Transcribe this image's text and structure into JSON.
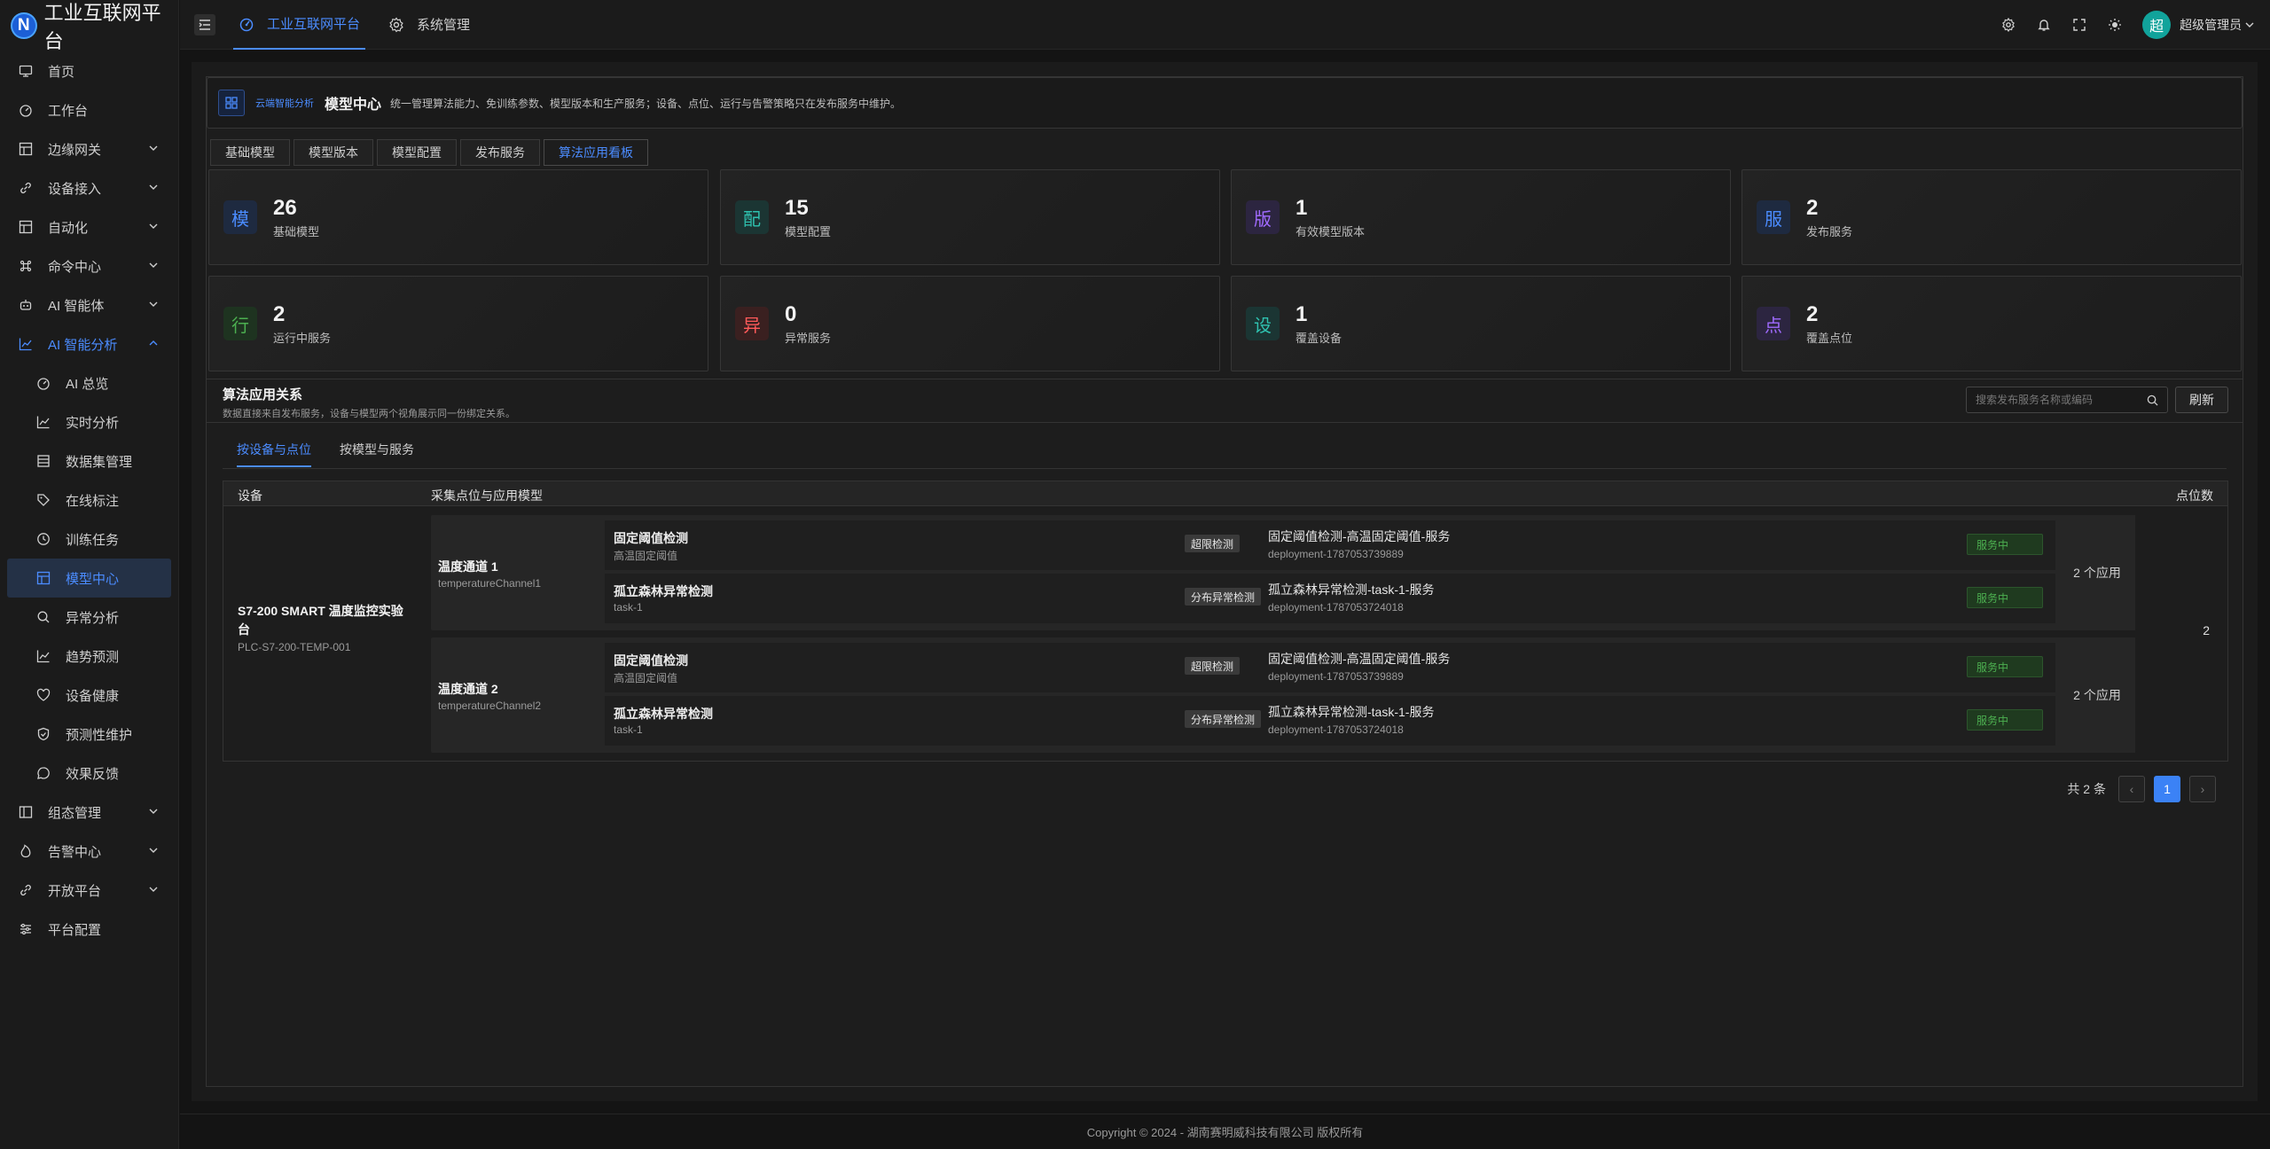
{
  "app": {
    "logo_letter": "N",
    "title": "工业互联网平台"
  },
  "header": {
    "tabs": [
      {
        "label": "工业互联网平台",
        "icon": "platform-icon"
      },
      {
        "label": "系统管理",
        "icon": "gear-icon"
      }
    ],
    "user": {
      "avatar_letter": "超",
      "name": "超级管理员"
    }
  },
  "sidebar": {
    "items": [
      {
        "label": "首页",
        "icon": "monitor-icon"
      },
      {
        "label": "工作台",
        "icon": "dashboard-icon"
      },
      {
        "label": "边缘网关",
        "icon": "grid-icon",
        "expandable": true
      },
      {
        "label": "设备接入",
        "icon": "link-icon",
        "expandable": true
      },
      {
        "label": "自动化",
        "icon": "grid-icon",
        "expandable": true
      },
      {
        "label": "命令中心",
        "icon": "command-icon",
        "expandable": true
      },
      {
        "label": "AI 智能体",
        "icon": "robot-icon",
        "expandable": true
      },
      {
        "label": "AI 智能分析",
        "icon": "chart-line-icon",
        "expandable": true,
        "open": true
      }
    ],
    "sub_items": [
      {
        "label": "AI 总览",
        "icon": "dashboard-icon"
      },
      {
        "label": "实时分析",
        "icon": "chart-line-icon"
      },
      {
        "label": "数据集管理",
        "icon": "table-icon"
      },
      {
        "label": "在线标注",
        "icon": "tag-icon"
      },
      {
        "label": "训练任务",
        "icon": "clock-icon"
      },
      {
        "label": "模型中心",
        "icon": "grid-icon",
        "active": true
      },
      {
        "label": "异常分析",
        "icon": "search-icon"
      },
      {
        "label": "趋势预测",
        "icon": "chart-line-icon"
      },
      {
        "label": "设备健康",
        "icon": "heart-icon"
      },
      {
        "label": "预测性维护",
        "icon": "shield-icon"
      },
      {
        "label": "效果反馈",
        "icon": "message-icon"
      }
    ],
    "bottom_items": [
      {
        "label": "组态管理",
        "icon": "layout-icon",
        "expandable": true
      },
      {
        "label": "告警中心",
        "icon": "fire-icon",
        "expandable": true
      },
      {
        "label": "开放平台",
        "icon": "link-icon",
        "expandable": true
      },
      {
        "label": "平台配置",
        "icon": "sliders-icon"
      }
    ]
  },
  "banner": {
    "tag": "云端智能分析",
    "title": "模型中心",
    "desc": "统一管理算法能力、免训练参数、模型版本和生产服务；设备、点位、运行与告警策略只在发布服务中维护。"
  },
  "tabs": [
    "基础模型",
    "模型版本",
    "模型配置",
    "发布服务",
    "算法应用看板"
  ],
  "active_tab": "算法应用看板",
  "stats": [
    {
      "glyph": "模",
      "value": "26",
      "label": "基础模型",
      "color": "#4b8cff",
      "bg": "#1e2a40"
    },
    {
      "glyph": "配",
      "value": "15",
      "label": "模型配置",
      "color": "#2fc2b0",
      "bg": "#1b3533"
    },
    {
      "glyph": "版",
      "value": "1",
      "label": "有效模型版本",
      "color": "#a06bff",
      "bg": "#2c2540"
    },
    {
      "glyph": "服",
      "value": "2",
      "label": "发布服务",
      "color": "#4b8cff",
      "bg": "#1e2a40"
    },
    {
      "glyph": "行",
      "value": "2",
      "label": "运行中服务",
      "color": "#4caf50",
      "bg": "#1e3320"
    },
    {
      "glyph": "异",
      "value": "0",
      "label": "异常服务",
      "color": "#ff5a5a",
      "bg": "#3a2020"
    },
    {
      "glyph": "设",
      "value": "1",
      "label": "覆盖设备",
      "color": "#2fc2b0",
      "bg": "#1b3533"
    },
    {
      "glyph": "点",
      "value": "2",
      "label": "覆盖点位",
      "color": "#a06bff",
      "bg": "#2c2540"
    }
  ],
  "relation": {
    "title": "算法应用关系",
    "subtitle": "数据直接来自发布服务，设备与模型两个视角展示同一份绑定关系。",
    "search_placeholder": "搜索发布服务名称或编码",
    "refresh_label": "刷新",
    "subtabs": [
      "按设备与点位",
      "按模型与服务"
    ],
    "active_subtab": "按设备与点位",
    "columns": [
      "设备",
      "采集点位与应用模型",
      "点位数"
    ],
    "device": {
      "name": "S7-200 SMART 温度监控实验台",
      "code": "PLC-S7-200-TEMP-001",
      "point_count": "2"
    },
    "channels": [
      {
        "name": "温度通道 1",
        "code": "temperatureChannel1",
        "app_count": "2 个应用",
        "apps": [
          {
            "name": "固定阈值检测",
            "desc": "高温固定阈值",
            "type": "超限检测",
            "service": "固定阈值检测-高温固定阈值-服务",
            "deployment": "deployment-1787053739889",
            "status": "服务中"
          },
          {
            "name": "孤立森林异常检测",
            "desc": "task-1",
            "type": "分布异常检测",
            "service": "孤立森林异常检测-task-1-服务",
            "deployment": "deployment-1787053724018",
            "status": "服务中"
          }
        ]
      },
      {
        "name": "温度通道 2",
        "code": "temperatureChannel2",
        "app_count": "2 个应用",
        "apps": [
          {
            "name": "固定阈值检测",
            "desc": "高温固定阈值",
            "type": "超限检测",
            "service": "固定阈值检测-高温固定阈值-服务",
            "deployment": "deployment-1787053739889",
            "status": "服务中"
          },
          {
            "name": "孤立森林异常检测",
            "desc": "task-1",
            "type": "分布异常检测",
            "service": "孤立森林异常检测-task-1-服务",
            "deployment": "deployment-1787053724018",
            "status": "服务中"
          }
        ]
      }
    ],
    "pagination": {
      "total": "共 2 条",
      "current": "1",
      "prev": "‹",
      "next": "›"
    }
  },
  "footer": "Copyright © 2024 - 湖南赛明威科技有限公司 版权所有"
}
